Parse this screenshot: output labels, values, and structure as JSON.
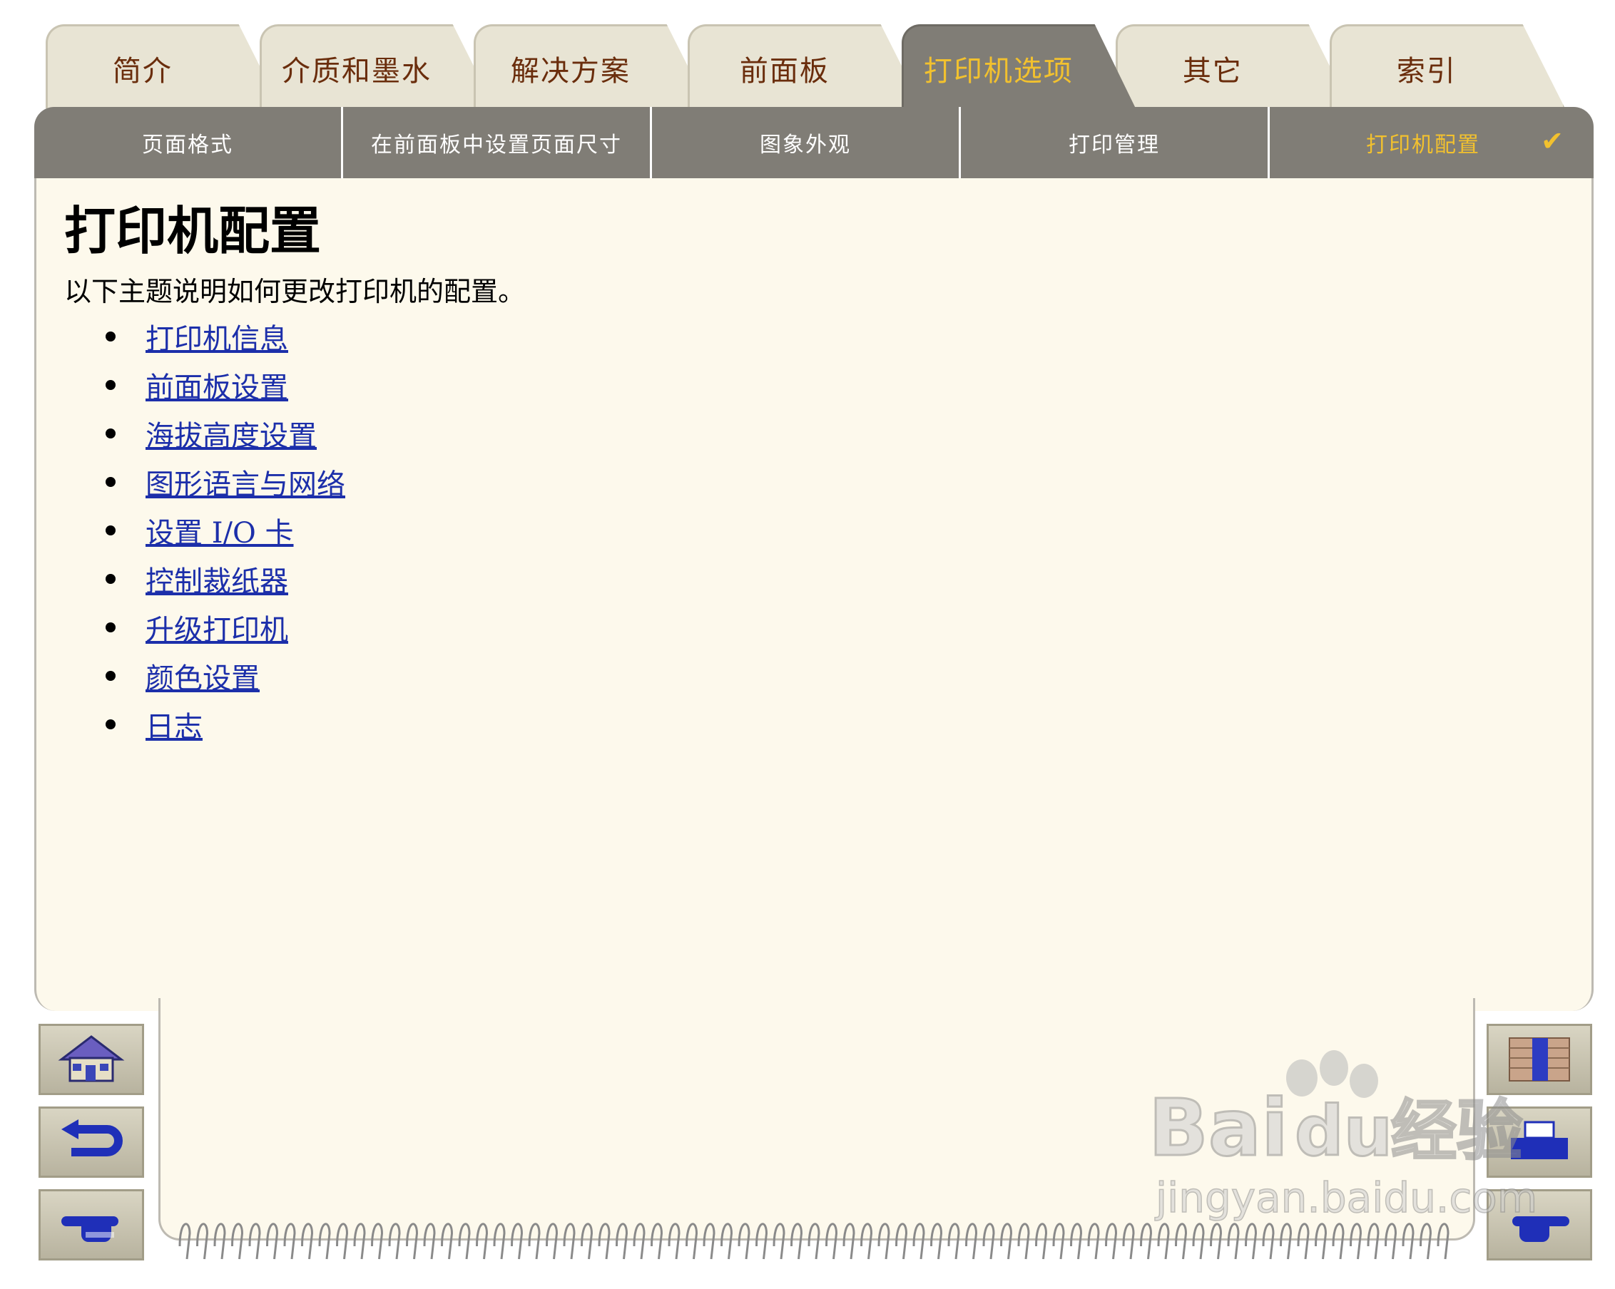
{
  "tabs": [
    {
      "label": "简介"
    },
    {
      "label": "介质和墨水"
    },
    {
      "label": "解决方案"
    },
    {
      "label": "前面板"
    },
    {
      "label": "打印机选项",
      "active": true
    },
    {
      "label": "其它"
    },
    {
      "label": "索引"
    }
  ],
  "subnav": [
    {
      "label": "页面格式"
    },
    {
      "label": "在前面板中设置页面尺寸"
    },
    {
      "label": "图象外观"
    },
    {
      "label": "打印管理"
    },
    {
      "label": "打印机配置",
      "active": true,
      "check": "✔"
    }
  ],
  "content": {
    "title": "打印机配置",
    "intro": "以下主题说明如何更改打印机的配置。",
    "links": [
      "打印机信息",
      "前面板设置",
      "海拔高度设置",
      "图形语言与网络",
      "设置 I/O 卡",
      "控制裁纸器",
      "升级打印机",
      "颜色设置",
      "日志"
    ]
  },
  "watermark": {
    "brand_latin": "Bai",
    "brand_du": "du",
    "brand_cn": "经验",
    "url": "jingyan.baidu.com"
  },
  "colors": {
    "tab_text": "#6a2d0c",
    "active_text": "#f2c12e",
    "link": "#1c2faa",
    "panel": "#fdf9ec",
    "nav_bar": "#807d76"
  },
  "icons": {
    "left": [
      "home-icon",
      "back-arrow-icon",
      "forward-hand-icon"
    ],
    "right": [
      "index-book-icon",
      "printer-icon",
      "next-hand-icon"
    ]
  }
}
